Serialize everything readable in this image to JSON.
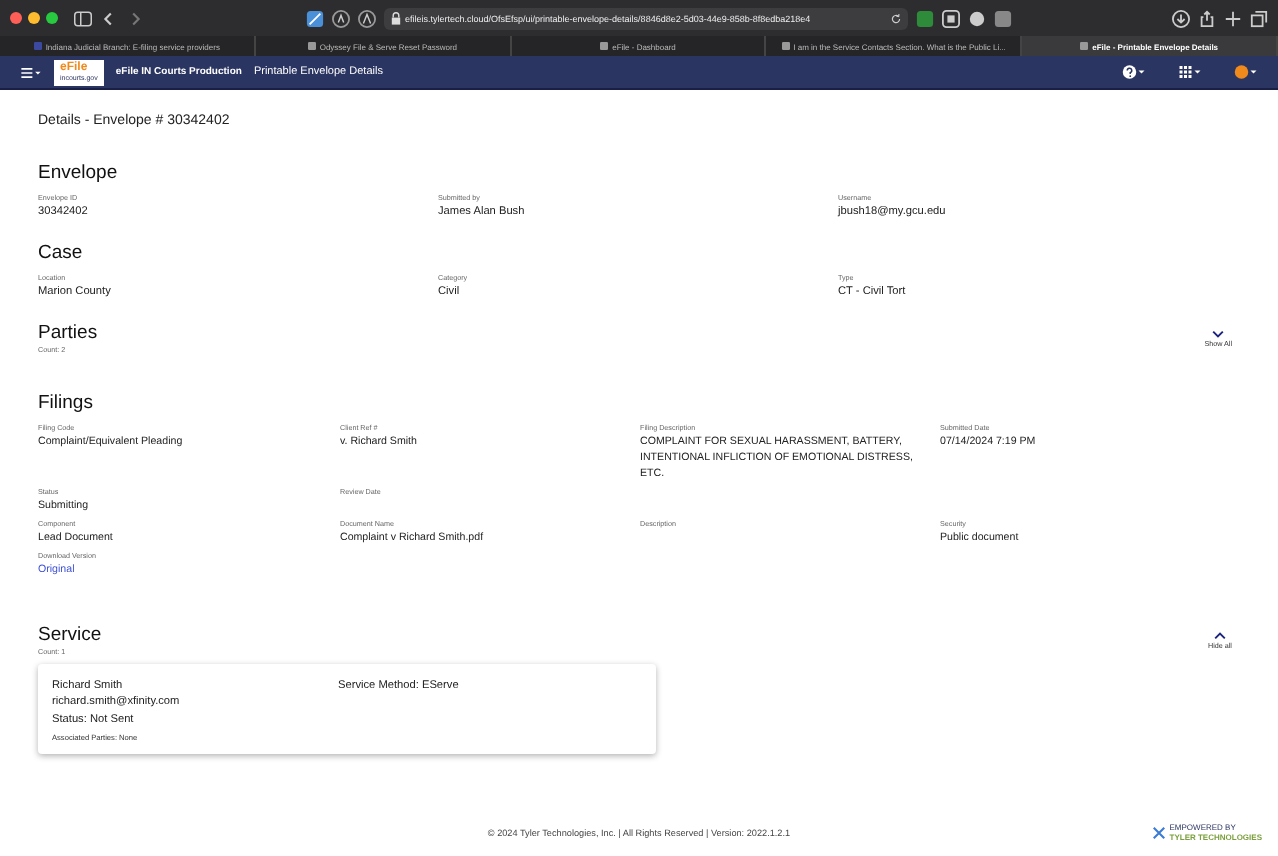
{
  "browser": {
    "url": "efileis.tylertech.cloud/OfsEfsp/ui/printable-envelope-details/8846d8e2-5d03-44e9-858b-8f8edba218e4",
    "tabs": [
      {
        "title": "Indiana Judicial Branch: E-filing service providers",
        "selected": false
      },
      {
        "title": "Odyssey File & Serve Reset Password",
        "selected": false
      },
      {
        "title": "eFile - Dashboard",
        "selected": false
      },
      {
        "title": "I am in the Service Contacts Section. What is the Public Li...",
        "selected": false
      },
      {
        "title": "eFile - Printable Envelope Details",
        "selected": true
      }
    ]
  },
  "app_bar": {
    "logo_lines": [
      "eFile",
      "incourts.gov"
    ],
    "app_name": "eFile IN Courts Production",
    "page_title": "Printable Envelope Details"
  },
  "page_title": "Details - Envelope # 30342402",
  "envelope": {
    "heading": "Envelope",
    "fields": [
      {
        "label": "Envelope ID",
        "value": "30342402"
      },
      {
        "label": "Submitted by",
        "value": "James Alan Bush"
      },
      {
        "label": "Username",
        "value": "jbush18@my.gcu.edu"
      }
    ]
  },
  "case": {
    "heading": "Case",
    "fields": [
      {
        "label": "Location",
        "value": "Marion County"
      },
      {
        "label": "Category",
        "value": "Civil"
      },
      {
        "label": "Type",
        "value": "CT - Civil Tort"
      }
    ]
  },
  "parties": {
    "heading": "Parties",
    "count": "Count: 2",
    "toggle": {
      "label": "Show All",
      "expanded": false
    }
  },
  "filings": {
    "heading": "Filings",
    "rows": [
      [
        {
          "label": "Filing Code",
          "value": "Complaint/Equivalent Pleading",
          "kind": "text"
        },
        {
          "label": "Client Ref #",
          "value": "v. Richard Smith",
          "kind": "text"
        },
        {
          "label": "Filing Description",
          "value": "COMPLAINT FOR SEXUAL HARASSMENT, BATTERY, INTENTIONAL INFLICTION OF EMOTIONAL DISTRESS, ETC.",
          "kind": "text"
        },
        {
          "label": "Submitted Date",
          "value": "07/14/2024 7:19 PM",
          "kind": "text"
        }
      ],
      [
        {
          "label": "Status",
          "value": "Submitting",
          "kind": "text"
        },
        {
          "label": "Review Date"
        }
      ],
      [
        {
          "label": "Component",
          "value": "Lead Document",
          "kind": "text"
        },
        {
          "label": "Document Name",
          "value": "Complaint v Richard Smith.pdf",
          "kind": "text"
        },
        {
          "label": "Description"
        },
        {
          "label": "Security",
          "value": "Public document",
          "kind": "text"
        }
      ],
      [
        {
          "label": "Download Version",
          "value": "Original",
          "kind": "link"
        }
      ]
    ]
  },
  "service": {
    "heading": "Service",
    "count": "Count: 1",
    "toggle": {
      "label": "Hide all",
      "expanded": true
    },
    "card": {
      "name": "Richard Smith",
      "email": "richard.smith@xfinity.com",
      "status": "Status: Not Sent",
      "method": "Service Method: EServe",
      "associated": "Associated Parties: None"
    }
  },
  "footer": {
    "copyright": "© 2024 Tyler Technologies, Inc. | All Rights Reserved | Version: 2022.1.2.1",
    "badge_lines": [
      "EMPOWERED BY",
      "TYLER TECHNOLOGIES"
    ]
  }
}
